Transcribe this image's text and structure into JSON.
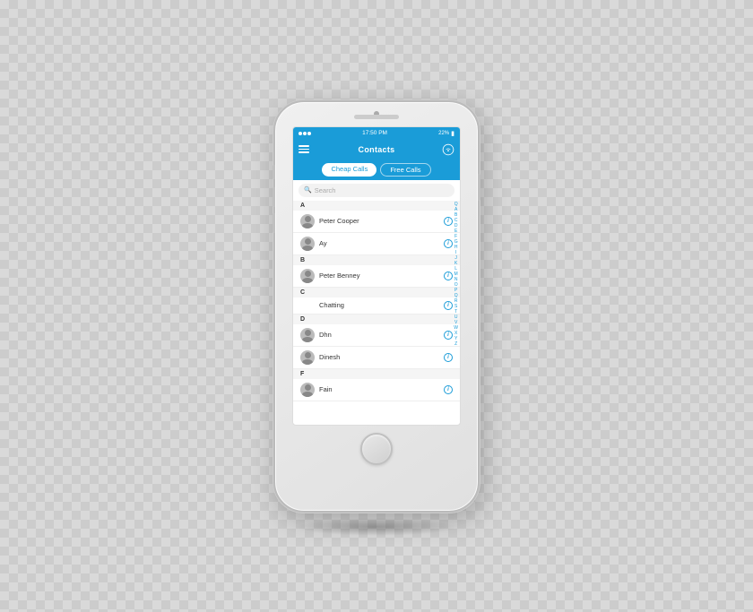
{
  "phone": {
    "status_bar": {
      "time": "17:50 PM",
      "battery": "22%",
      "dots": [
        "•",
        "•",
        "•"
      ]
    },
    "header": {
      "title": "Contacts",
      "menu_label": "menu",
      "wifi_label": "wifi-icon"
    },
    "tabs": [
      {
        "label": "Cheap Calls",
        "active": true
      },
      {
        "label": "Free Calls",
        "active": false
      }
    ],
    "search": {
      "placeholder": "Search"
    },
    "alphabet": [
      "Q",
      "A",
      "B",
      "C",
      "D",
      "E",
      "F",
      "G",
      "H",
      "I",
      "J",
      "K",
      "L",
      "M",
      "N",
      "O",
      "P",
      "Q",
      "R",
      "S",
      "T",
      "U",
      "V",
      "W",
      "X",
      "Y",
      "Z"
    ],
    "sections": [
      {
        "letter": "A",
        "contacts": [
          {
            "name": "Peter Cooper",
            "has_avatar": true
          },
          {
            "name": "Ay",
            "has_avatar": true
          }
        ]
      },
      {
        "letter": "B",
        "contacts": [
          {
            "name": "Peter Benney",
            "has_avatar": true
          }
        ]
      },
      {
        "letter": "C",
        "contacts": [
          {
            "name": "Chatting",
            "has_avatar": false
          }
        ]
      },
      {
        "letter": "D",
        "contacts": [
          {
            "name": "Dhn",
            "has_avatar": true
          },
          {
            "name": "Dinesh",
            "has_avatar": true
          }
        ]
      },
      {
        "letter": "F",
        "contacts": [
          {
            "name": "Fain",
            "has_avatar": true
          }
        ]
      }
    ]
  }
}
